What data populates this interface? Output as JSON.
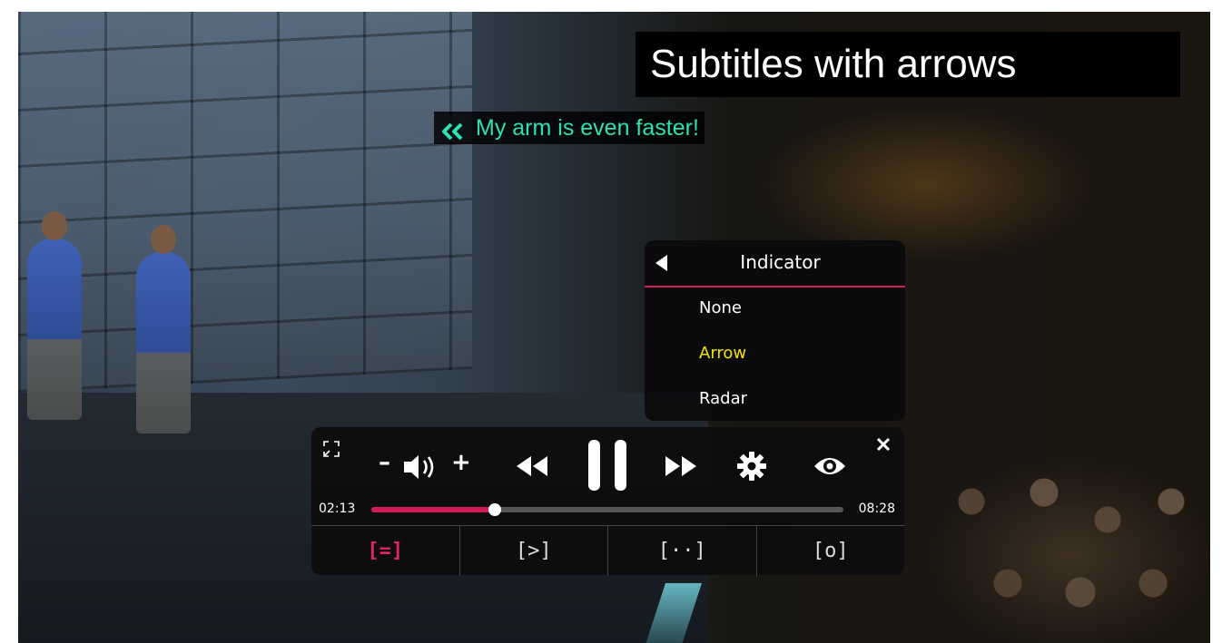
{
  "overlay": {
    "title": "Subtitles with arrows"
  },
  "subtitle": {
    "text": "My arm is even faster!",
    "indicator_icon": "double-chevron-left-icon",
    "color": "#2ee0b2"
  },
  "indicator_menu": {
    "title": "Indicator",
    "accent": "#d31b58",
    "items": [
      {
        "label": "None",
        "selected": false
      },
      {
        "label": "Arrow",
        "selected": true
      },
      {
        "label": "Radar",
        "selected": false
      }
    ],
    "selected_color": "#f2e400"
  },
  "player": {
    "volume_minus": "–",
    "volume_plus": "+",
    "time_current": "02:13",
    "time_total": "08:28",
    "progress": 0.262,
    "accent": "#d31b58",
    "modes": [
      {
        "label": "[=]",
        "active": true
      },
      {
        "label": "[>]",
        "active": false
      },
      {
        "label": "[··]",
        "active": false
      },
      {
        "label": "[o]",
        "active": false
      }
    ]
  }
}
